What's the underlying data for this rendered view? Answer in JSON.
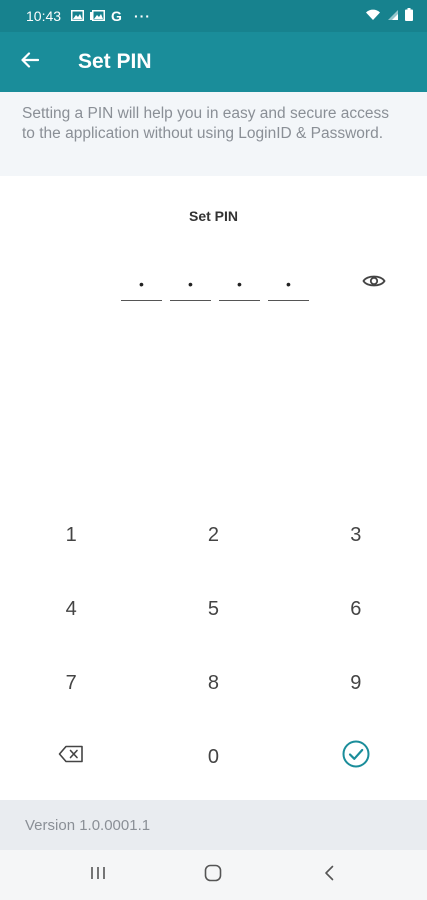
{
  "status_bar": {
    "time": "10:43",
    "google_letter": "G",
    "more": "···"
  },
  "app_bar": {
    "title": "Set PIN"
  },
  "info": {
    "text": "Setting a PIN will help you in easy and secure access to the application without using LoginID & Password."
  },
  "pin": {
    "label": "Set PIN",
    "slots": [
      "•",
      "•",
      "•",
      "•"
    ]
  },
  "keypad": {
    "rows": [
      [
        "1",
        "2",
        "3"
      ],
      [
        "4",
        "5",
        "6"
      ],
      [
        "7",
        "8",
        "9"
      ],
      [
        "backspace-icon",
        "0",
        "submit-check-icon"
      ]
    ]
  },
  "footer": {
    "version": "Version 1.0.0001.1"
  },
  "colors": {
    "app_bar": "#1a8d9a",
    "status_bar": "#17828e",
    "accent": "#1a8d9a"
  }
}
